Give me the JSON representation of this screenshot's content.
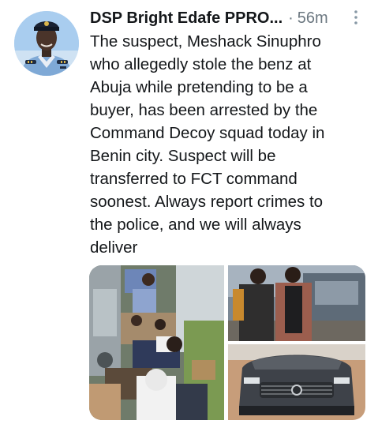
{
  "tweet": {
    "author_name": "DSP Bright Edafe PPRO...",
    "separator": "·",
    "time": "56m",
    "text": "The suspect, Meshack Sinuphro\nwho allegedly stole the benz at\nAbuja while pretending to be a\nbuyer, has been arrested by the\nCommand Decoy squad today in\nBenin city. Suspect will be\ntransferred to FCT command\nsoonest. Always report crimes to\nthe police, and we will always\ndeliver"
  },
  "icons": {
    "avatar": "police-officer-avatar",
    "more": "more-vertical-icon"
  },
  "media": {
    "photos": [
      {
        "name": "crowd-at-scene-photo"
      },
      {
        "name": "suspect-with-officer-photo"
      },
      {
        "name": "recovered-mercedes-photo"
      }
    ]
  },
  "colors": {
    "text": "#14171a",
    "secondary": "#6b7780",
    "background": "#ffffff"
  }
}
